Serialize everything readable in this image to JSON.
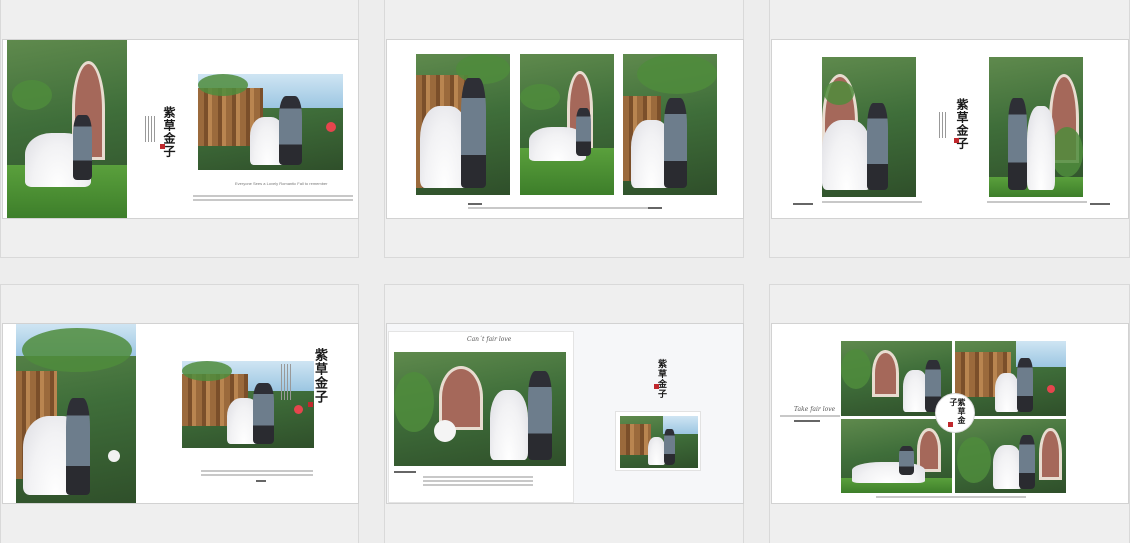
{
  "gallery": {
    "title_calligraphy": "紫草金子",
    "script_caption": "Can´t fair love",
    "script_caption_alt": "Take fair love",
    "caption_lines": [
      "Everyone Sees a Lovely Romantic Fall to remember",
      "Everyone Sees a Romantic fall to remember",
      "I remember you so beautiful"
    ],
    "cards": [
      {
        "id": "template-1",
        "layout": "single-left-plus-right"
      },
      {
        "id": "template-2",
        "layout": "three-panel"
      },
      {
        "id": "template-3",
        "layout": "two-photo-with-title"
      },
      {
        "id": "template-4",
        "layout": "single-left-with-text"
      },
      {
        "id": "template-5",
        "layout": "framed-photo-with-insert"
      },
      {
        "id": "template-6",
        "layout": "four-grid-with-badge"
      }
    ],
    "colors": {
      "background": "#ededed",
      "cell": "#efefef",
      "spread": "#ffffff",
      "accent_seal": "#c0282d",
      "grass": "#5aa03c",
      "wood": "#9b6a3c"
    }
  }
}
